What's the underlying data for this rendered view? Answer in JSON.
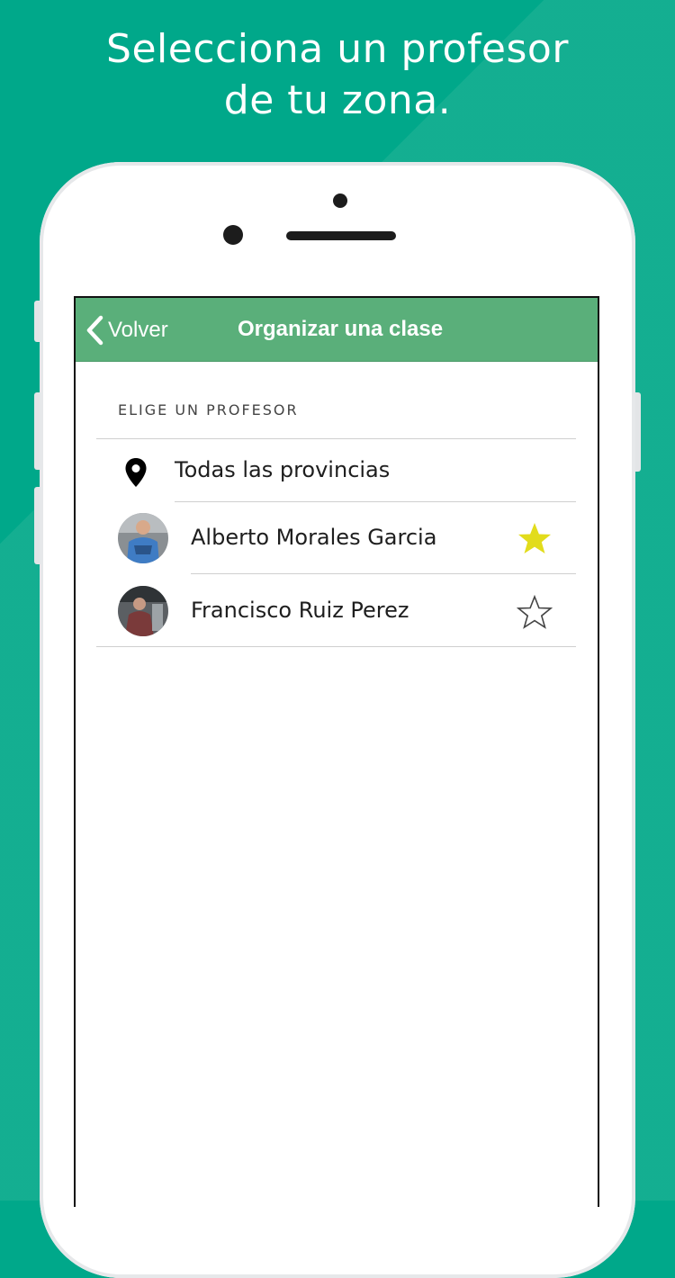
{
  "headline": {
    "line1": "Selecciona un profesor",
    "line2": "de tu zona."
  },
  "navbar": {
    "back_label": "Volver",
    "title": "Organizar una clase"
  },
  "section": {
    "heading": "ELIGE UN PROFESOR"
  },
  "location": {
    "label": "Todas las provincias",
    "icon": "map-pin-icon"
  },
  "teachers": [
    {
      "name": "Alberto Morales Garcia",
      "favorite": true
    },
    {
      "name": "Francisco Ruiz Perez",
      "favorite": false
    }
  ],
  "colors": {
    "background": "#00a88a",
    "navbar": "#5aaf7a",
    "star_filled": "#e2dc1c"
  }
}
